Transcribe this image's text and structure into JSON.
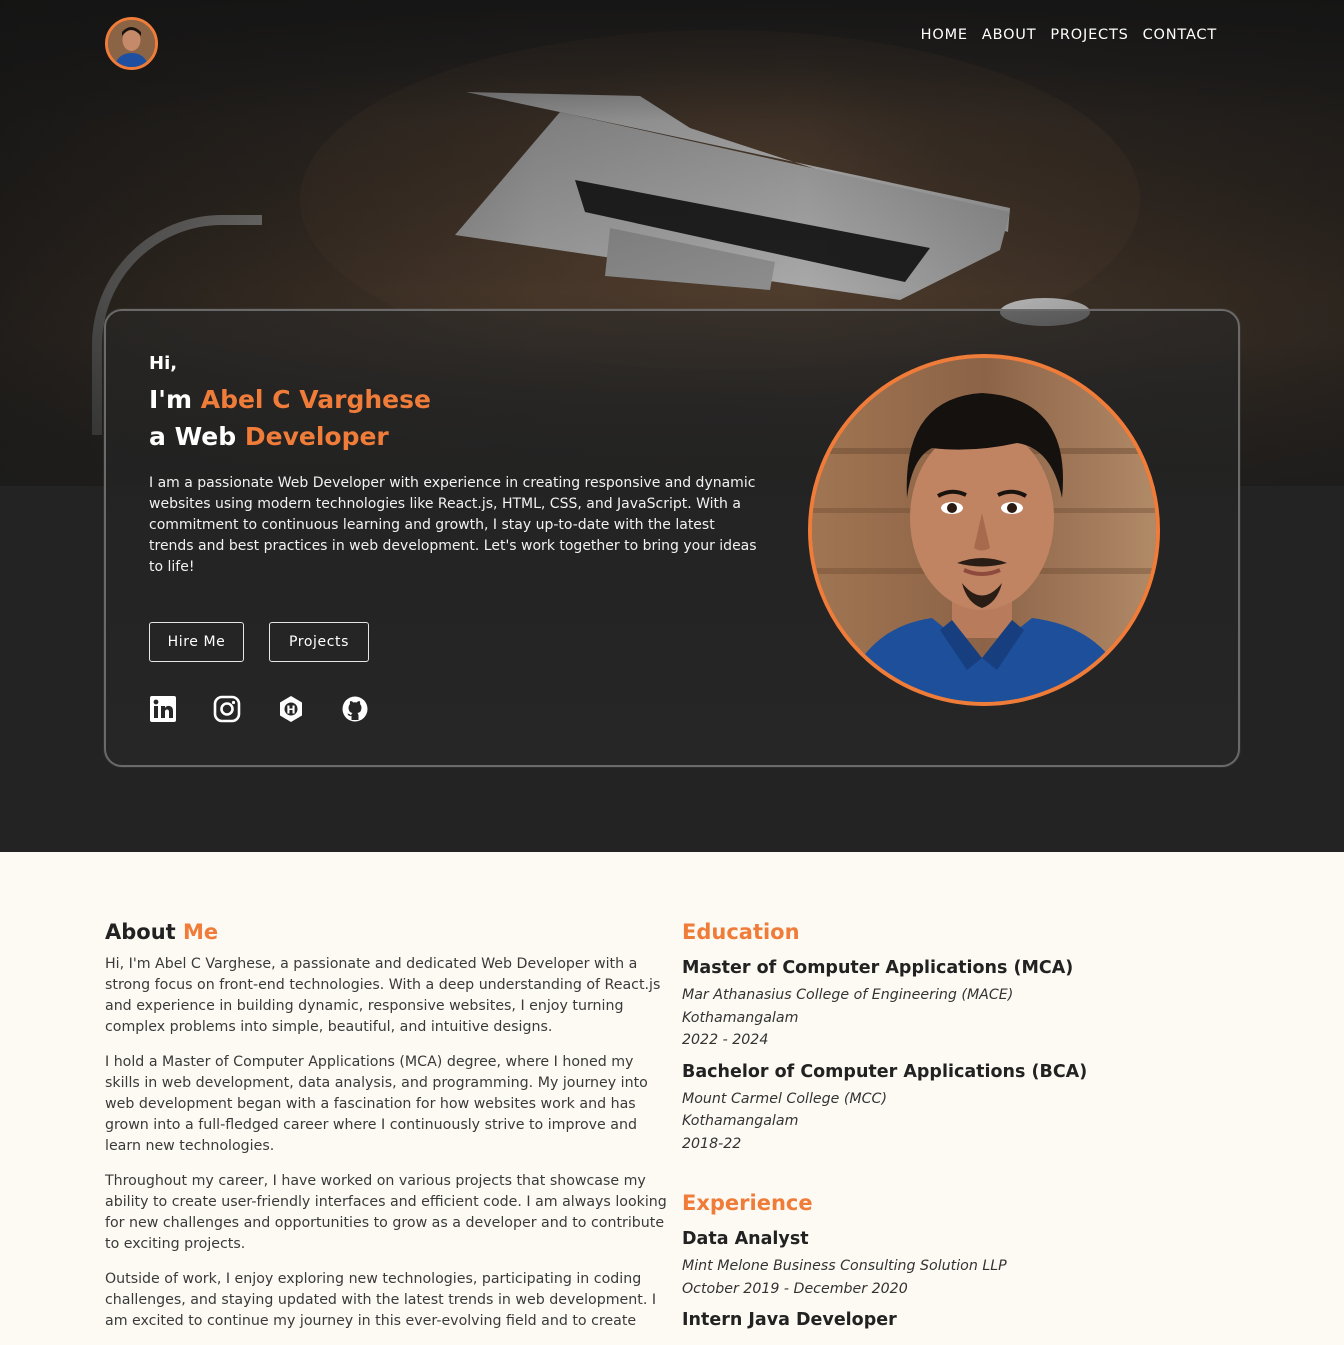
{
  "nav": {
    "links": [
      "HOME",
      "ABOUT",
      "PROJECTS",
      "CONTACT"
    ]
  },
  "hero": {
    "greeting": "Hi,",
    "im": "I'm",
    "name": "Abel C Varghese",
    "a": "a",
    "web": "Web",
    "role": "Developer",
    "intro": "I am a passionate Web Developer with experience in creating responsive and dynamic websites using modern technologies like React.js, HTML, CSS, and JavaScript. With a commitment to continuous learning and growth, I stay up-to-date with the latest trends and best practices in web development. Let's work together to bring your ideas to life!",
    "hire_label": "Hire Me",
    "projects_label": "Projects",
    "socials": [
      "linkedin-icon",
      "instagram-icon",
      "hashnode-icon",
      "github-icon"
    ]
  },
  "about": {
    "title_prefix": "About",
    "title_accent": "Me",
    "paragraphs": [
      "Hi, I'm Abel C Varghese, a passionate and dedicated Web Developer with a strong focus on front-end technologies. With a deep understanding of React.js and experience in building dynamic, responsive websites, I enjoy turning complex problems into simple, beautiful, and intuitive designs.",
      "I hold a Master of Computer Applications (MCA) degree, where I honed my skills in web development, data analysis, and programming. My journey into web development began with a fascination for how websites work and has grown into a full-fledged career where I continuously strive to improve and learn new technologies.",
      "Throughout my career, I have worked on various projects that showcase my ability to create user-friendly interfaces and efficient code. I am always looking for new challenges and opportunities to grow as a developer and to contribute to exciting projects.",
      "Outside of work, I enjoy exploring new technologies, participating in coding challenges, and staying updated with the latest trends in web development. I am excited to continue my journey in this ever-evolving field and to create"
    ]
  },
  "education": {
    "title": "Education",
    "items": [
      {
        "degree": "Master of Computer Applications (MCA)",
        "college": "Mar Athanasius College of Engineering (MACE)",
        "place": "Kothamangalam",
        "years": "2022 - 2024"
      },
      {
        "degree": "Bachelor of Computer Applications (BCA)",
        "college": "Mount Carmel College (MCC)",
        "place": "Kothamangalam",
        "years": "2018-22"
      }
    ]
  },
  "experience": {
    "title": "Experience",
    "items": [
      {
        "role": "Data Analyst",
        "company": "Mint Melone Business Consulting Solution LLP",
        "period": "October 2019 - December 2020"
      },
      {
        "role": "Intern Java Developer"
      }
    ]
  },
  "colors": {
    "accent": "#f07c3a",
    "dark": "#232323",
    "cream": "#fdfaf3"
  }
}
